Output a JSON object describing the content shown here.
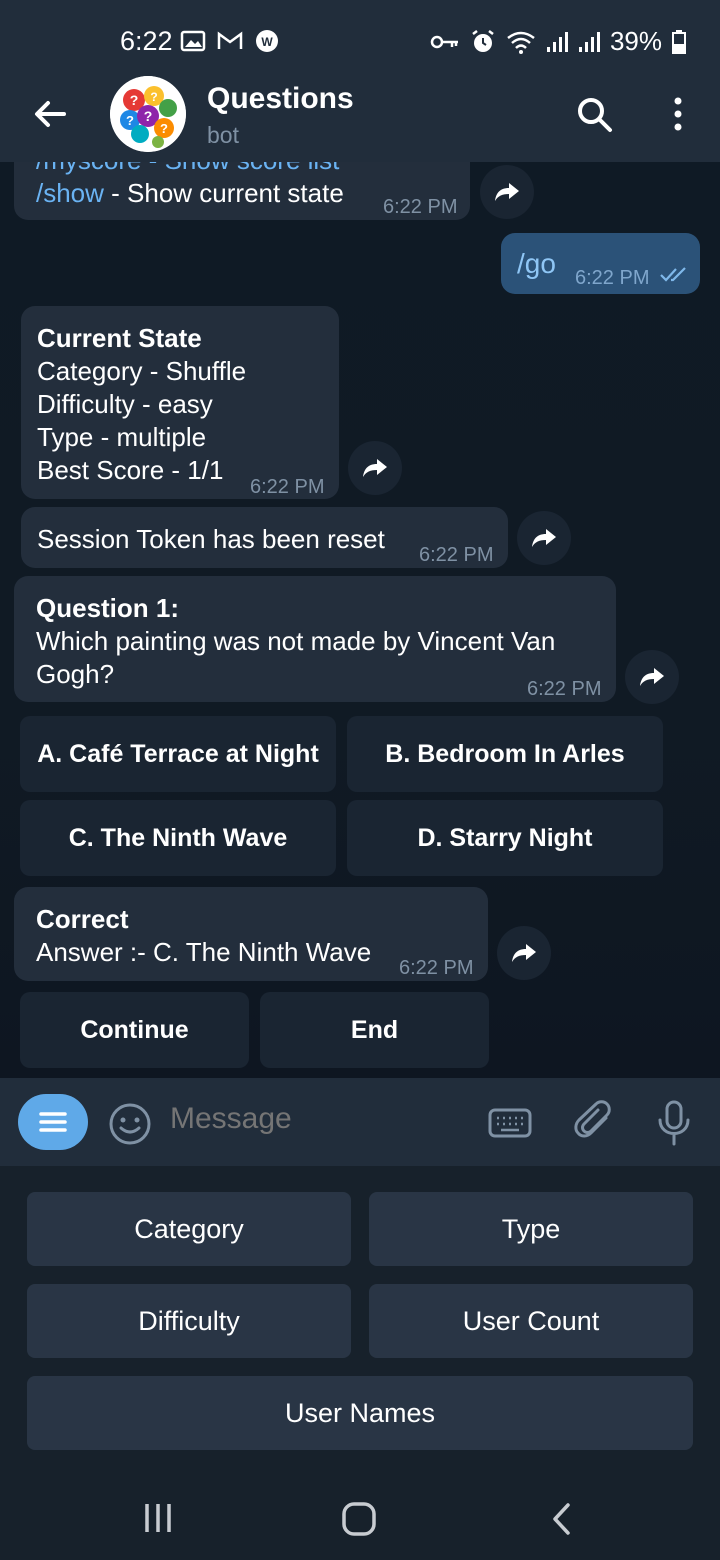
{
  "status_bar": {
    "time": "6:22",
    "battery": "39%"
  },
  "header": {
    "title": "Questions",
    "subtitle": "bot"
  },
  "messages": {
    "partial_line": "/myscore - Show score list",
    "cmd_show": "/show",
    "cmd_show_desc": " - Show current state",
    "cmd_time": "6:22 PM",
    "go_text": "/go",
    "go_time": "6:22 PM",
    "state_lines": [
      "Current State",
      "Category - Shuffle",
      "Difficulty - easy",
      "Type - multiple",
      "Best Score - 1/1"
    ],
    "state_time": "6:22 PM",
    "token_text": "Session Token has been reset",
    "token_time": "6:22 PM",
    "question_title": "Question 1:",
    "question_text": "Which painting was not made by Vincent Van Gogh?",
    "question_time": "6:22 PM",
    "options": [
      "A. Café Terrace at Night",
      "B. Bedroom In Arles",
      "C. The Ninth Wave",
      "D. Starry Night"
    ],
    "result_title": "Correct",
    "result_text": "Answer :- C. The Ninth Wave",
    "result_time": "6:22 PM",
    "continue_label": "Continue",
    "end_label": "End"
  },
  "input": {
    "placeholder": "Message"
  },
  "keyboard": {
    "category": "Category",
    "type": "Type",
    "difficulty": "Difficulty",
    "user_count": "User Count",
    "user_names": "User Names"
  },
  "colors": {
    "accent": "#5fa9e8",
    "link": "#6ab3f3",
    "outgoing_bubble": "#2b5278",
    "incoming_bubble": "#232e3c"
  }
}
